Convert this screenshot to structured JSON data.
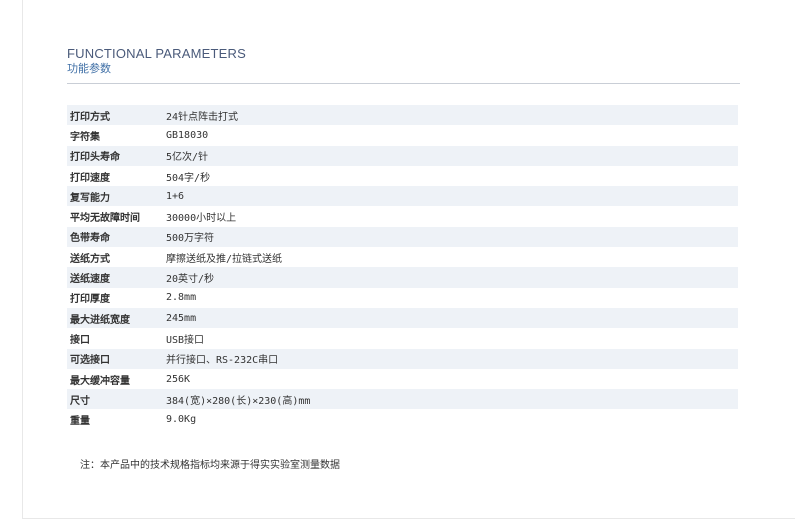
{
  "header": {
    "title_en": "FUNCTIONAL PARAMETERS",
    "title_cn": "功能参数"
  },
  "params": [
    {
      "key": "打印方式",
      "value": "24针点阵击打式"
    },
    {
      "key": "字符集",
      "value": "GB18030"
    },
    {
      "key": "打印头寿命",
      "value": "5亿次/针"
    },
    {
      "key": "打印速度",
      "value": "504字/秒"
    },
    {
      "key": "复写能力",
      "value": "1+6"
    },
    {
      "key": "平均无故障时间",
      "value": "30000小时以上"
    },
    {
      "key": "色带寿命",
      "value": "500万字符"
    },
    {
      "key": "送纸方式",
      "value": "摩擦送纸及推/拉链式送纸"
    },
    {
      "key": "送纸速度",
      "value": "20英寸/秒"
    },
    {
      "key": "打印厚度",
      "value": "2.8mm"
    },
    {
      "key": "最大进纸宽度",
      "value": "245mm"
    },
    {
      "key": "接口",
      "value": "USB接口"
    },
    {
      "key": "可选接口",
      "value": "并行接口、RS-232C串口"
    },
    {
      "key": "最大缓冲容量",
      "value": "256K"
    },
    {
      "key": "尺寸",
      "value": "384(宽)×280(长)×230(高)mm"
    },
    {
      "key": "重量",
      "value": "9.0Kg"
    }
  ],
  "note": "注：本产品中的技术规格指标均来源于得实实验室测量数据",
  "colors": {
    "row_stripe": "#eef2f7",
    "title_en": "#4a5a7a",
    "title_cn": "#3f6fa6",
    "rule": "#c9ced6"
  }
}
